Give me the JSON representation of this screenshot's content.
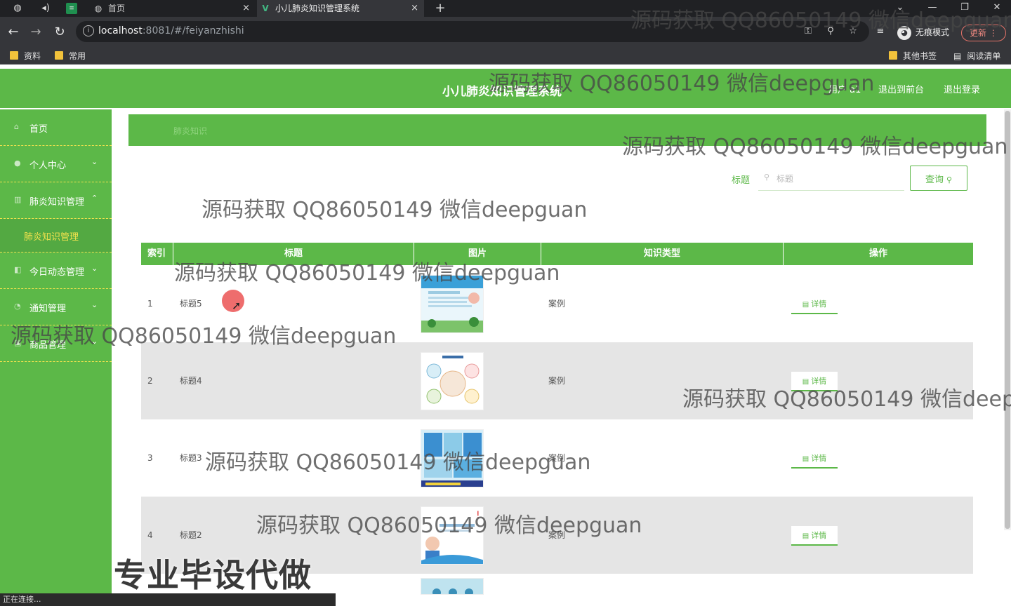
{
  "browser": {
    "tabs": [
      {
        "label": "首页",
        "close": "×"
      },
      {
        "label": "小儿肺炎知识管理系统",
        "close": "×"
      }
    ],
    "new_tab": "+",
    "window_controls": {
      "dropdown": "⌄",
      "minimize": "—",
      "restore": "❐",
      "close": "✕"
    },
    "url_host": "localhost",
    "url_rest": ":8081/#/feiyanzhishi",
    "incognito_label": "无痕模式",
    "update_label": "更新",
    "bookmarks": [
      {
        "label": "资料"
      },
      {
        "label": "常用"
      }
    ],
    "other_bookmarks": "其他书签",
    "reading_list": "阅读清单",
    "status_text": "正在连接..."
  },
  "header": {
    "title": "小儿肺炎知识管理系统",
    "user": "用户 a1",
    "back_to_front": "退出到前台",
    "logout": "退出登录"
  },
  "sidebar": {
    "items": [
      {
        "label": "首页",
        "icon": "home-icon"
      },
      {
        "label": "个人中心",
        "icon": "user-icon",
        "arrow": "⌄"
      },
      {
        "label": "肺炎知识管理",
        "icon": "book-icon",
        "arrow": "⌃"
      },
      {
        "label": "肺炎知识管理",
        "submenu": true
      },
      {
        "label": "今日动态管理",
        "icon": "news-icon",
        "arrow": "⌄"
      },
      {
        "label": "通知管理",
        "icon": "bell-icon",
        "arrow": "⌄"
      },
      {
        "label": "商品管理",
        "icon": "cart-icon",
        "arrow": "⌄"
      }
    ]
  },
  "breadcrumb": "肺炎知识",
  "search": {
    "label": "标题",
    "placeholder": "标题",
    "button": "查询"
  },
  "table": {
    "columns": [
      "索引",
      "标题",
      "图片",
      "知识类型",
      "操作"
    ],
    "rows": [
      {
        "index": "1",
        "title": "标题5",
        "type": "案例",
        "action": "详情"
      },
      {
        "index": "2",
        "title": "标题4",
        "type": "案例",
        "action": "详情"
      },
      {
        "index": "3",
        "title": "标题3",
        "type": "案例",
        "action": "详情"
      },
      {
        "index": "4",
        "title": "标题2",
        "type": "案例",
        "action": "详情"
      }
    ]
  },
  "overlay": {
    "watermark": "源码获取 QQ86050149 微信deepguan",
    "banner": "专业毕设代做"
  },
  "colors": {
    "primary_green": "#5cb848",
    "menu_active_yellow": "#f2e24d",
    "row_alt": "#e5e5e5"
  }
}
